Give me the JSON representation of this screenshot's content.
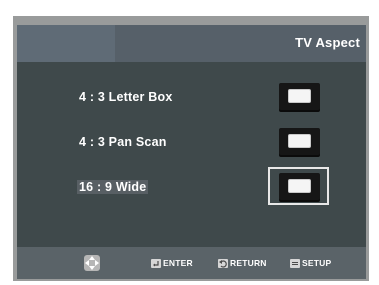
{
  "header": {
    "title": "TV Aspect"
  },
  "options": [
    {
      "label": "4 : 3  Letter Box",
      "selected": false,
      "icon": "radio-button"
    },
    {
      "label": "4 : 3 Pan Scan",
      "selected": false,
      "icon": "radio-button"
    },
    {
      "label": "16 : 9 Wide",
      "selected": true,
      "icon": "radio-button"
    }
  ],
  "footer": {
    "nav_icon": "directional-pad-icon",
    "enter_label": "ENTER",
    "return_label": "RETURN",
    "setup_label": "SETUP"
  }
}
